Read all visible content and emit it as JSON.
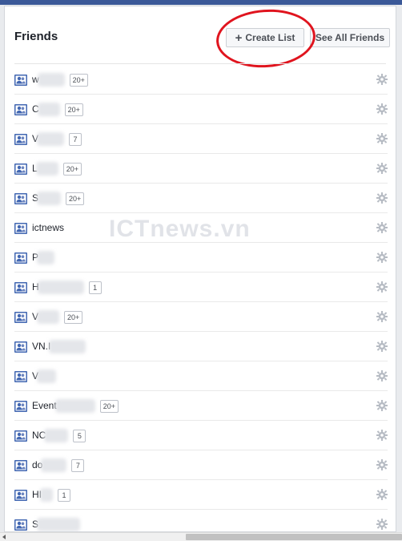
{
  "panel": {
    "title": "Friends",
    "create_list_label": "Create List",
    "see_all_label": "See All Friends"
  },
  "watermark": "ICTnews.vn",
  "friends": [
    {
      "name": "w",
      "count": "20+"
    },
    {
      "name": "C",
      "count": "20+"
    },
    {
      "name": "V",
      "count": "7"
    },
    {
      "name": "L",
      "count": "20+"
    },
    {
      "name": "S",
      "count": "20+"
    },
    {
      "name": "ictnews",
      "count": ""
    },
    {
      "name": "P",
      "count": ""
    },
    {
      "name": "H",
      "count": "1"
    },
    {
      "name": "V",
      "count": "20+"
    },
    {
      "name": "VN.I",
      "count": ""
    },
    {
      "name": "V",
      "count": ""
    },
    {
      "name": "Event",
      "count": "20+"
    },
    {
      "name": "NC",
      "count": "5"
    },
    {
      "name": "do",
      "count": "7"
    },
    {
      "name": "HI",
      "count": "1"
    },
    {
      "name": "S",
      "count": ""
    }
  ],
  "icons": {
    "friend_list": "friends-list-icon",
    "settings": "gear-icon",
    "create": "plus-icon"
  },
  "colors": {
    "brand": "#3b5998",
    "annotation": "#e0141e"
  }
}
